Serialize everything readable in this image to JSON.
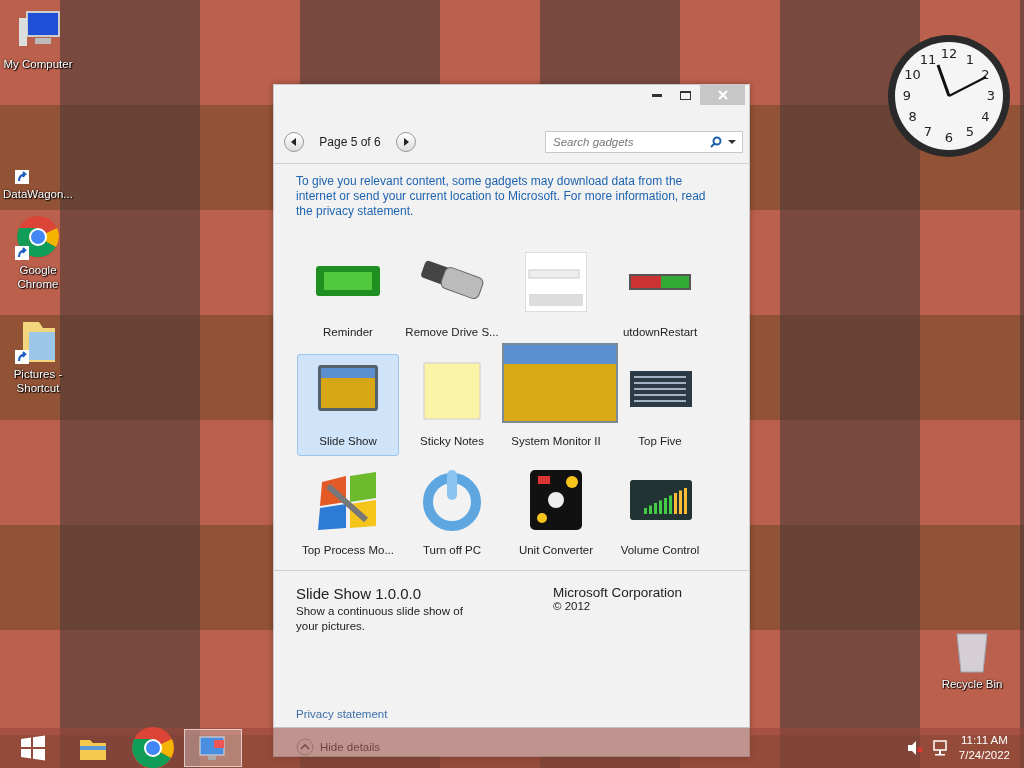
{
  "desktop_icons": [
    {
      "kind": "computer",
      "label": "My Computer",
      "shortcut": false
    },
    {
      "kind": "blank",
      "label": "DataWagon...",
      "shortcut": true
    },
    {
      "kind": "chrome",
      "label": "Google Chrome",
      "shortcut": true
    },
    {
      "kind": "folder",
      "label": "Pictures - Shortcut",
      "shortcut": true
    },
    {
      "kind": "bin",
      "label": "Recycle Bin",
      "shortcut": false
    }
  ],
  "clock_gadget": {
    "numbers": [
      "11",
      "12",
      "1",
      "10",
      "2",
      "9",
      "3",
      "8",
      "4",
      "7",
      "5",
      "6"
    ]
  },
  "window": {
    "pager": {
      "label": "Page 5 of 6"
    },
    "search": {
      "placeholder": "Search gadgets"
    },
    "notice": "To give you relevant content, some gadgets may download data from the internet or send your current location to Microsoft. For more information, read the privacy statement.",
    "gadgets": [
      {
        "kind": "timer",
        "label": "Reminder",
        "selected": false
      },
      {
        "kind": "usb",
        "label": "Remove Drive S...",
        "selected": false
      },
      {
        "kind": "google"
      },
      {
        "kind": "power-bar",
        "label": "utdownRestart",
        "selected": false
      },
      {
        "kind": "slideshow",
        "label": "Slide Show",
        "selected": true
      },
      {
        "kind": "note",
        "label": "Sticky Notes",
        "selected": false
      },
      {
        "kind": "none",
        "label": "System Monitor II",
        "selected": false
      },
      {
        "kind": "list",
        "label": "Top Five",
        "selected": false
      },
      {
        "kind": "tools",
        "label": "Top Process Mo...",
        "selected": false
      },
      {
        "kind": "power",
        "label": "Turn off PC",
        "selected": false
      },
      {
        "kind": "units",
        "label": "Unit Converter",
        "selected": false
      },
      {
        "kind": "volume",
        "label": "Volume Control",
        "selected": false
      }
    ],
    "details": {
      "title": "Slide Show 1.0.0.0",
      "description": "Show a continuous slide show of your pictures.",
      "publisher": "Microsoft Corporation",
      "copyright": "© 2012",
      "privacy_link": "Privacy statement"
    },
    "toggle": {
      "label": "Hide details"
    }
  },
  "taskbar": {
    "apps": [
      {
        "kind": "explorer",
        "selected": false
      },
      {
        "kind": "chrome",
        "selected": false
      },
      {
        "kind": "gadgets",
        "selected": true
      }
    ],
    "time": "11:11 AM",
    "date": "7/24/2022"
  }
}
